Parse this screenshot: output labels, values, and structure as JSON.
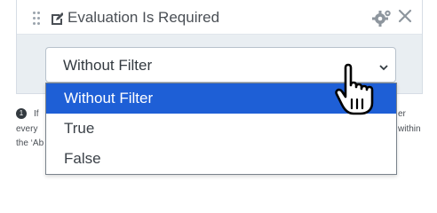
{
  "panel": {
    "title": "Evaluation Is Required",
    "icons": {
      "drag": "drag-handle-icon",
      "title": "edit-pencil-icon",
      "settings": "gear-icon",
      "close": "close-icon"
    }
  },
  "select": {
    "value": "Without Filter",
    "options": [
      {
        "label": "Without Filter",
        "selected": true
      },
      {
        "label": "True",
        "selected": false
      },
      {
        "label": "False",
        "selected": false
      }
    ]
  },
  "help": {
    "number": "1",
    "fragments": [
      "If",
      "every",
      "the ‘Ab",
      "er",
      "within"
    ]
  },
  "colors": {
    "selected_option": "#1e5fd6",
    "panel_bg": "#e9eef2"
  }
}
